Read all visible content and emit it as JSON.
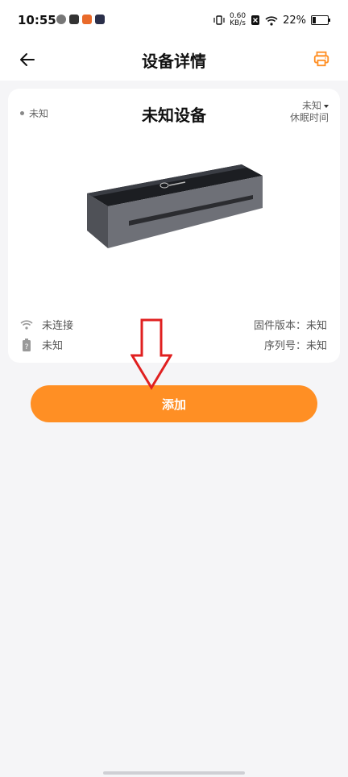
{
  "status_bar": {
    "time": "10:55",
    "speed_value": "0.60",
    "speed_unit": "KB/s",
    "battery": "22%"
  },
  "header": {
    "title": "设备详情",
    "back_icon": "arrow-left-icon",
    "print_icon": "printer-icon"
  },
  "device": {
    "status": "未知",
    "name": "未知设备",
    "sleep_value": "未知",
    "sleep_label": "休眠时间",
    "connection": "未连接",
    "battery_status": "未知",
    "firmware_label": "固件版本：未知",
    "serial_label": "序列号：未知"
  },
  "actions": {
    "add_label": "添加"
  },
  "colors": {
    "accent": "#ff8f24",
    "arrow": "#e02020"
  }
}
